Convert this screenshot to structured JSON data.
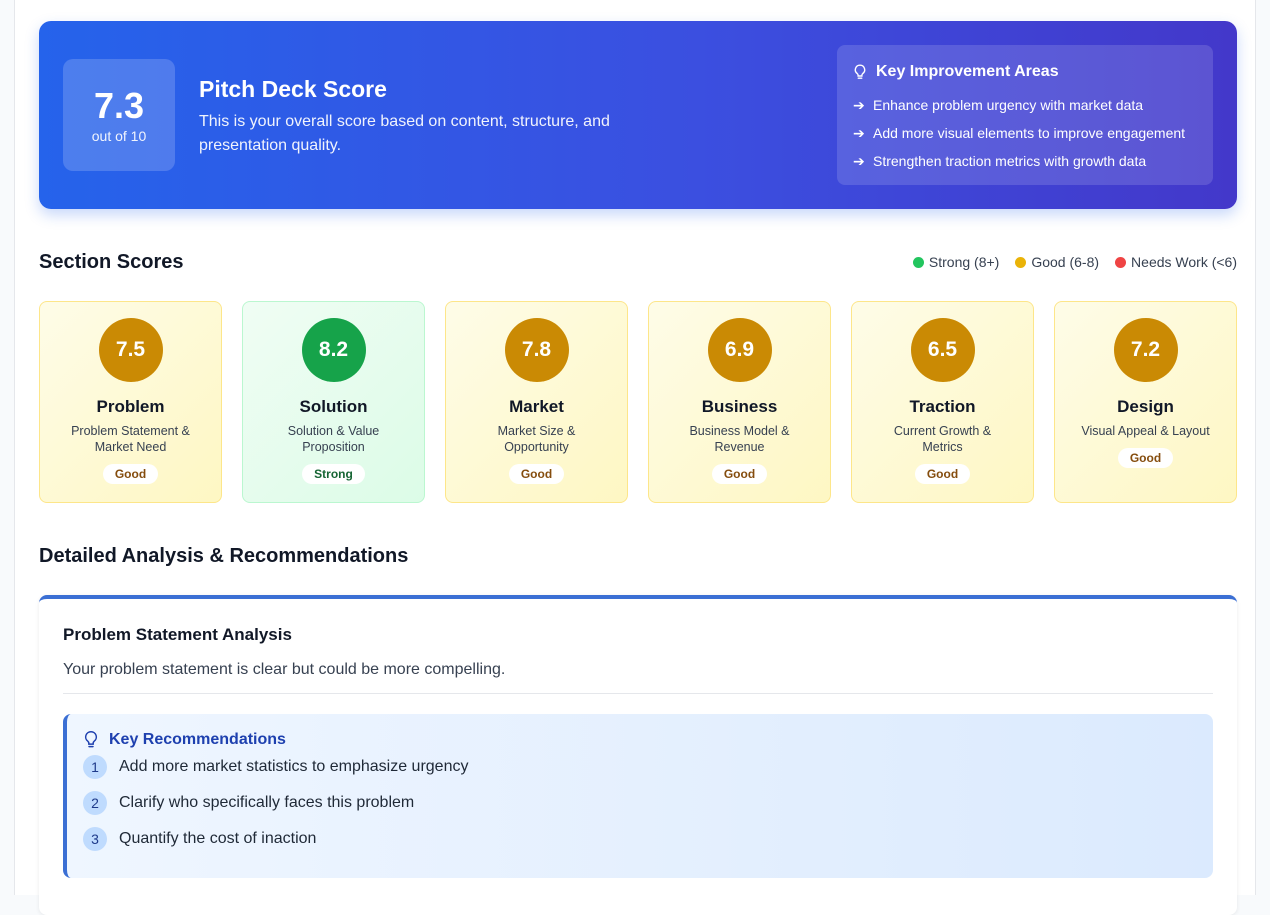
{
  "hero": {
    "score": "7.3",
    "score_sub": "out of 10",
    "title": "Pitch Deck Score",
    "description": "This is your overall score based on content, structure, and presentation quality.",
    "improvement_title": "Key Improvement Areas",
    "improvements": [
      "Enhance problem urgency with market data",
      "Add more visual elements to improve engagement",
      "Strengthen traction metrics with growth data"
    ]
  },
  "section_scores": {
    "title": "Section Scores",
    "legend": [
      {
        "label": "Strong (8+)",
        "color": "#22c55e"
      },
      {
        "label": "Good (6-8)",
        "color": "#eab308"
      },
      {
        "label": "Needs Work (<6)",
        "color": "#ef4444"
      }
    ],
    "cards": [
      {
        "score": "7.5",
        "name": "Problem",
        "desc": "Problem Statement & Market Need",
        "badge": "Good"
      },
      {
        "score": "8.2",
        "name": "Solution",
        "desc": "Solution & Value Proposition",
        "badge": "Strong"
      },
      {
        "score": "7.8",
        "name": "Market",
        "desc": "Market Size & Opportunity",
        "badge": "Good"
      },
      {
        "score": "6.9",
        "name": "Business",
        "desc": "Business Model & Revenue",
        "badge": "Good"
      },
      {
        "score": "6.5",
        "name": "Traction",
        "desc": "Current Growth & Metrics",
        "badge": "Good"
      },
      {
        "score": "7.2",
        "name": "Design",
        "desc": "Visual Appeal & Layout",
        "badge": "Good"
      }
    ]
  },
  "detailed": {
    "title": "Detailed Analysis & Recommendations",
    "card_title": "Problem Statement Analysis",
    "card_text": "Your problem statement is clear but could be more compelling.",
    "rec_title": "Key Recommendations",
    "recommendations": [
      {
        "num": "1",
        "text": "Add more market statistics to emphasize urgency"
      },
      {
        "num": "2",
        "text": "Clarify who specifically faces this problem"
      },
      {
        "num": "3",
        "text": "Quantify the cost of inaction"
      }
    ]
  }
}
